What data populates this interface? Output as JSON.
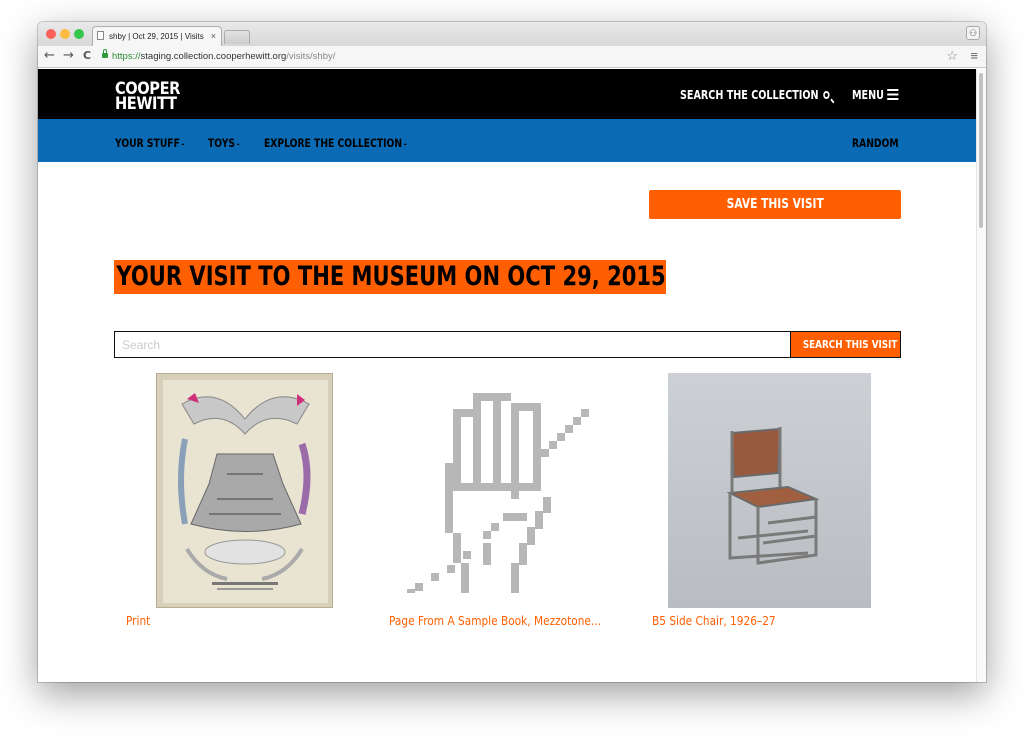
{
  "browser": {
    "tab_title": "shby | Oct 29, 2015 | Visits",
    "tab_close": "×",
    "url_scheme": "https://",
    "url_host": "staging.collection.cooperhewitt.org",
    "url_path": "/visits/shby/",
    "back": "←",
    "forward": "→",
    "reload": "C",
    "star": "☆",
    "menu": "≡",
    "traffic_lights": [
      "#fc605b",
      "#fdbc40",
      "#34c84a"
    ]
  },
  "header": {
    "logo_line1": "COOPER",
    "logo_line2": "HEWITT",
    "search_collection": "SEARCH THE COLLECTION",
    "menu": "MENU"
  },
  "nav": {
    "items": [
      {
        "label": "YOUR STUFF"
      },
      {
        "label": "TOYS"
      },
      {
        "label": "EXPLORE THE COLLECTION"
      }
    ],
    "caret": "-",
    "random": "RANDOM"
  },
  "page": {
    "save_visit": "SAVE THIS VISIT",
    "heading": "YOUR VISIT TO THE MUSEUM ON OCT 29, 2015",
    "search_placeholder": "Search",
    "search_button": "SEARCH THIS VISIT"
  },
  "objects": [
    {
      "caption": "Print",
      "icon": "fashion-plate-image"
    },
    {
      "caption": "Page From A Sample Book, Mezzotone...",
      "icon": "pixel-hand-placeholder"
    },
    {
      "caption": "B5 Side Chair, 1926–27",
      "icon": "chair-image"
    }
  ],
  "colors": {
    "accent": "#ff5f00",
    "nav_blue": "#0a6ab3",
    "topbar": "#000000"
  }
}
